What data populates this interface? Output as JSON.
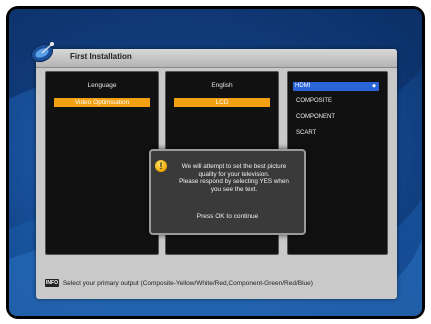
{
  "window": {
    "title": "First Installation"
  },
  "settings": {
    "labels": [
      "Lenguage",
      "Video Optimisation"
    ],
    "values": [
      "English",
      "LCD"
    ]
  },
  "output_options": {
    "items": [
      "HDMI",
      "COMPOSITE",
      "COMPONENT",
      "SCART"
    ],
    "selected": "HDMI"
  },
  "dialog": {
    "lines": [
      "We will attempt to set the best picture",
      "quality for your television.",
      "Please respond by selecting YES when",
      "you see the text."
    ],
    "ok_text": "Press OK to continue"
  },
  "footer": {
    "info_icon_label": "INFO",
    "hint": "Select your primary output (Composite-Yellow/White/Red,Component-Green/Red/Blue)"
  },
  "colors": {
    "highlight": "#f3a012",
    "selection": "#2a64d8",
    "panel_bg": "#111111",
    "window_bg": "#c9c9c9"
  }
}
